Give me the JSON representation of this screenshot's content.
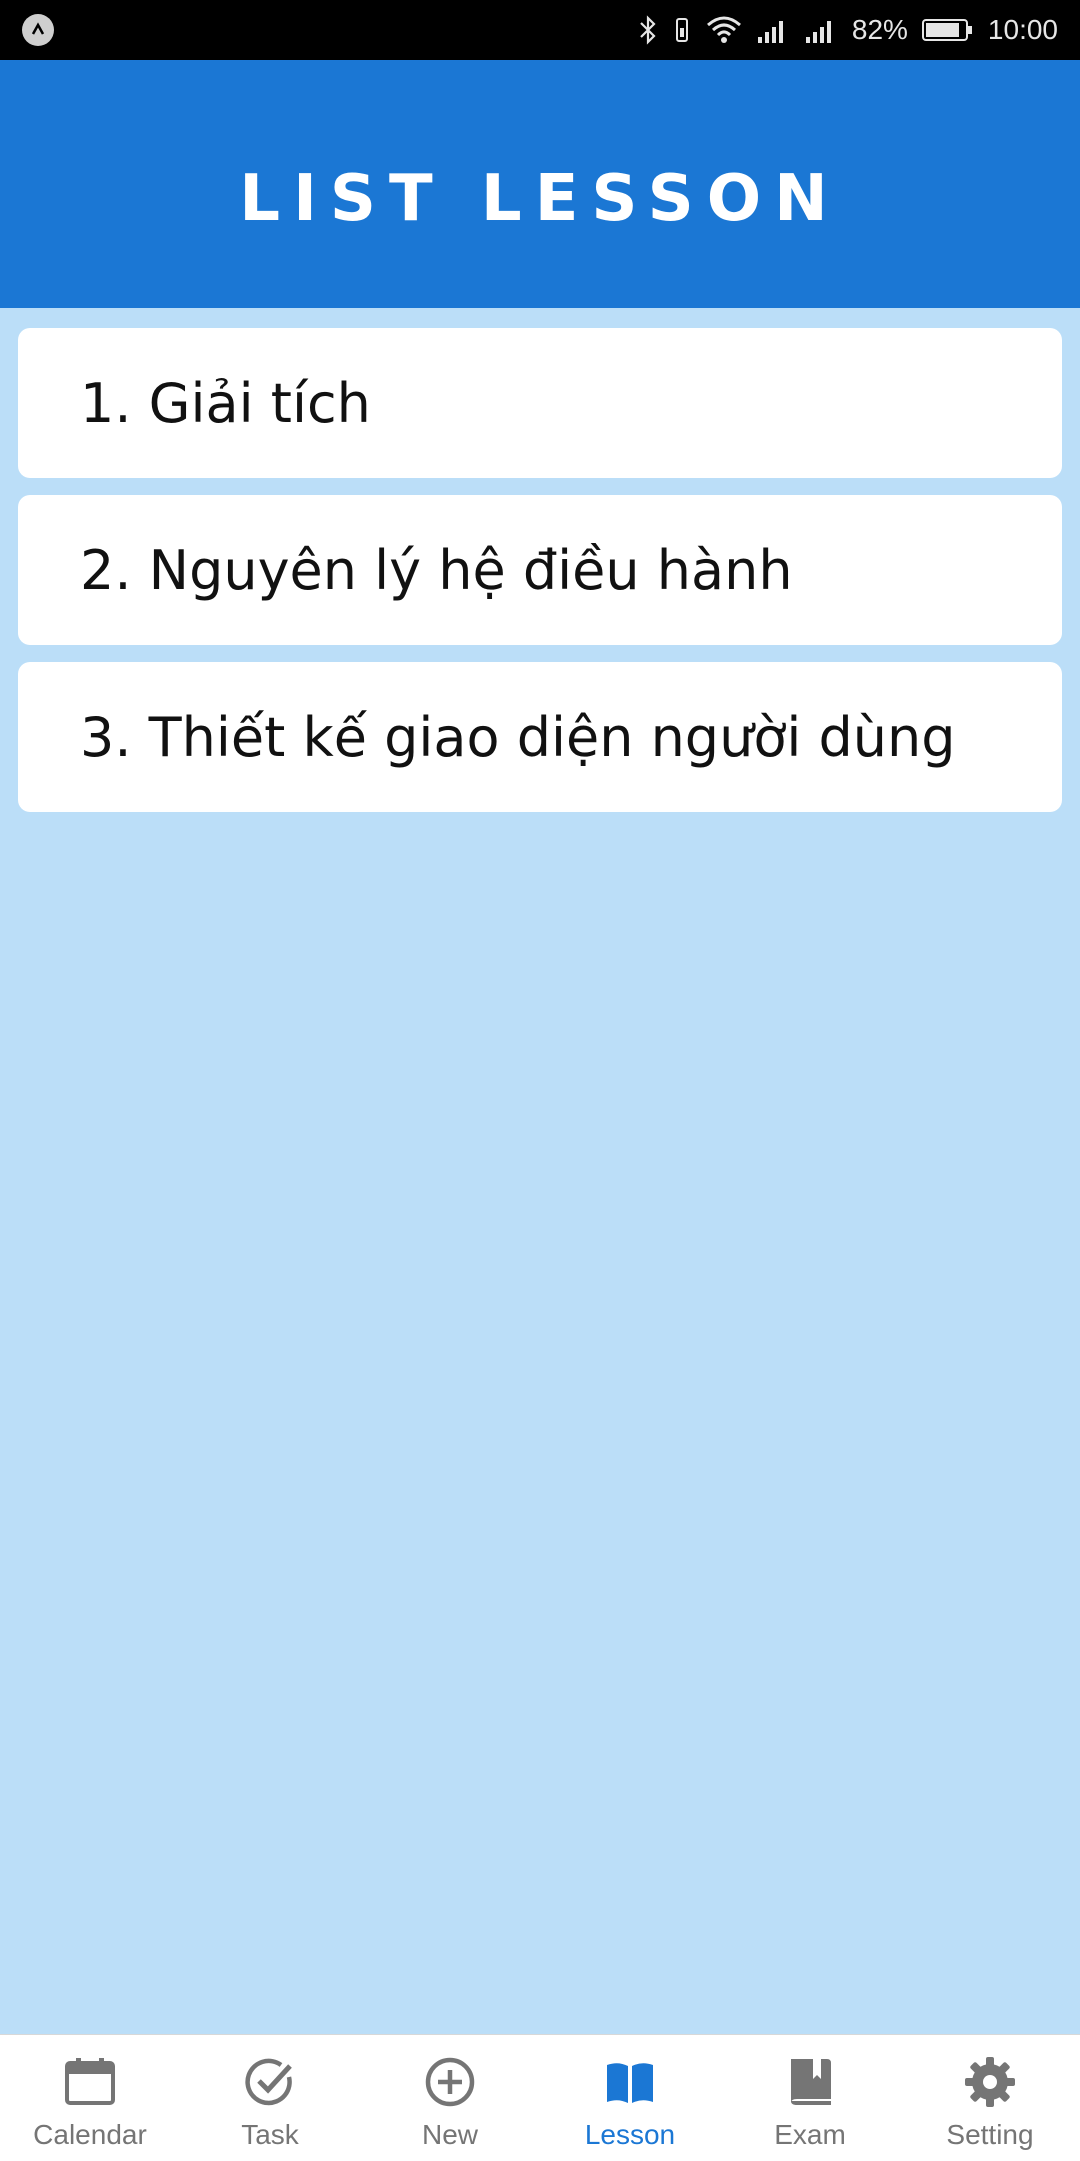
{
  "status_bar": {
    "battery_percent": "82%",
    "time": "10:00",
    "icons": [
      "app-notification-icon",
      "bluetooth-icon",
      "vibrate-icon",
      "wifi-icon",
      "signal-icon",
      "signal-icon",
      "battery-icon"
    ]
  },
  "header": {
    "title": "LIST LESSON"
  },
  "lessons": [
    {
      "label": "1. Giải tích"
    },
    {
      "label": "2. Nguyên lý hệ điều hành"
    },
    {
      "label": "3. Thiết kế giao diện người dùng"
    }
  ],
  "tabs": [
    {
      "label": "Calendar",
      "icon": "calendar-icon",
      "active": false
    },
    {
      "label": "Task",
      "icon": "check-circle-icon",
      "active": false
    },
    {
      "label": "New",
      "icon": "plus-circle-icon",
      "active": false
    },
    {
      "label": "Lesson",
      "icon": "open-book-icon",
      "active": true
    },
    {
      "label": "Exam",
      "icon": "closed-book-icon",
      "active": false
    },
    {
      "label": "Setting",
      "icon": "gear-icon",
      "active": false
    }
  ],
  "colors": {
    "header_bg": "#1b77d4",
    "page_bg": "#bbdef8",
    "active_tab": "#1b77d4",
    "inactive_tab": "#757575"
  }
}
